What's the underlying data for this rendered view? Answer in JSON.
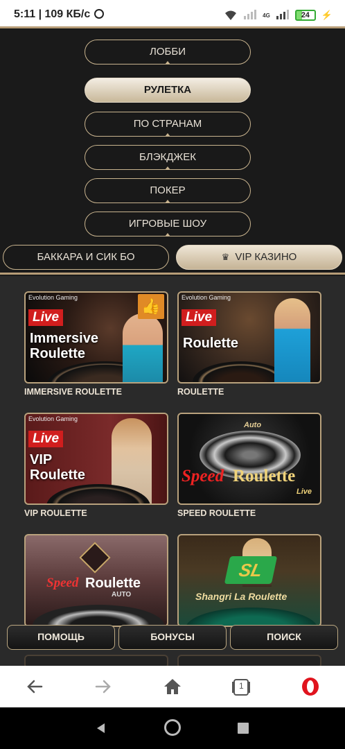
{
  "status": {
    "time_speed": "5:11 | 109 КБ/с",
    "network": "4G",
    "battery": "24"
  },
  "menu": {
    "items": [
      {
        "label": "ЛОББИ"
      },
      {
        "label": "РУЛЕТКА"
      },
      {
        "label": "ПО СТРАНАМ"
      },
      {
        "label": "БЛЭКДЖЕК"
      },
      {
        "label": "ПОКЕР"
      },
      {
        "label": "ИГРОВЫЕ ШОУ"
      },
      {
        "label": "БАККАРА И СИК БО"
      },
      {
        "label": "VIP КАЗИНО"
      }
    ],
    "active": "РУЛЕТКА"
  },
  "games": [
    {
      "title": "IMMERSIVE ROULETTE",
      "provider": "Evolution Gaming",
      "badge": "Live",
      "art_line1": "Immersive",
      "art_line2": "Roulette"
    },
    {
      "title": "ROULETTE",
      "provider": "Evolution Gaming",
      "badge": "Live",
      "art_line1": "Roulette"
    },
    {
      "title": "VIP ROULETTE",
      "provider": "Evolution Gaming",
      "badge": "Live",
      "art_line1": "VIP",
      "art_line2": "Roulette"
    },
    {
      "title": "SPEED ROULETTE",
      "art_top": "Auto",
      "art_speed": "Speed",
      "art_roulette": "Roulette",
      "art_sub": "Live"
    },
    {
      "title": "",
      "art_speed": "Speed",
      "art_roulette": "Roulette",
      "art_sub": "AUTO"
    },
    {
      "title": "",
      "art_logo": "SL",
      "art_line1": "Shangri La Roulette"
    }
  ],
  "bottom": {
    "help": "ПОМОЩЬ",
    "bonus": "БОНУСЫ",
    "search": "ПОИСК"
  },
  "browser": {
    "tabs_count": "1"
  },
  "colors": {
    "gold": "#c9b48f",
    "live_red": "#d11e1e",
    "opera_red": "#e0141e"
  }
}
